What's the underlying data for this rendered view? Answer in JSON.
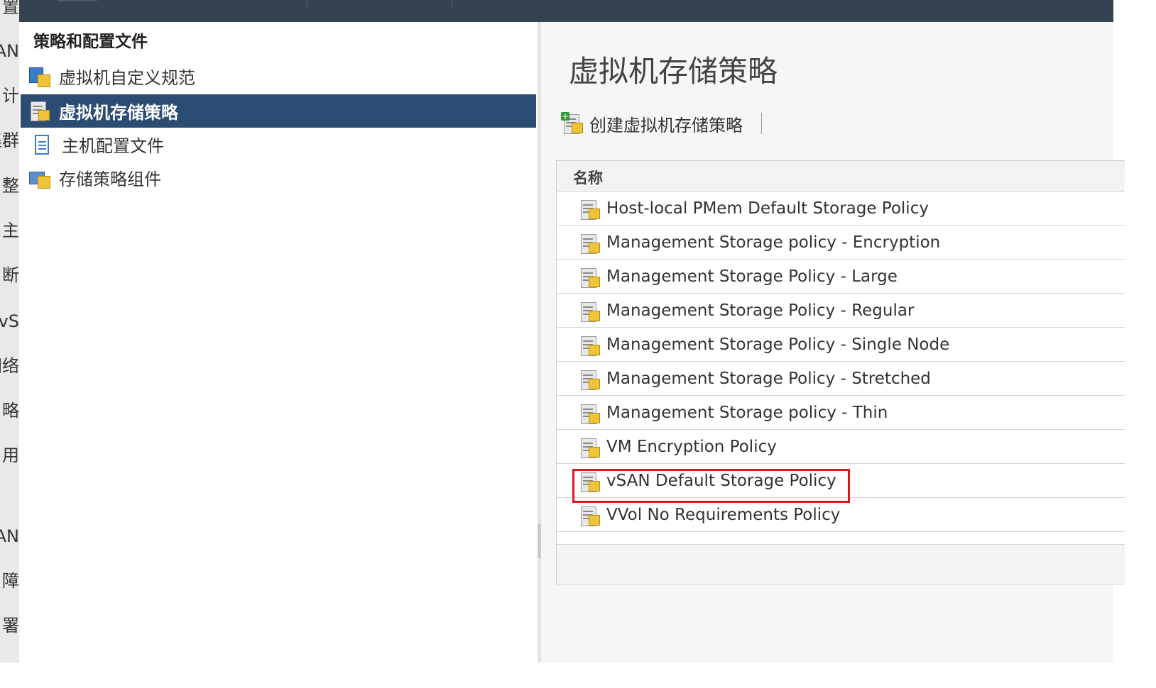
{
  "left_strip": [
    "置",
    "AN",
    "计",
    "集群",
    "整",
    "主",
    "断",
    "vS",
    "网络",
    "略",
    "用",
    "AN",
    "障",
    "署"
  ],
  "nav": {
    "title": "策略和配置文件",
    "items": [
      {
        "label": "虚拟机自定义规范",
        "icon": "vm-customization-spec-icon",
        "selected": false
      },
      {
        "label": "虚拟机存储策略",
        "icon": "vm-storage-policy-icon",
        "selected": true
      },
      {
        "label": "主机配置文件",
        "icon": "host-profile-icon",
        "selected": false
      },
      {
        "label": "存储策略组件",
        "icon": "storage-policy-component-icon",
        "selected": false
      }
    ]
  },
  "content": {
    "title": "虚拟机存储策略",
    "toolbar": {
      "create_label": "创建虚拟机存储策略"
    },
    "table": {
      "column_name": "名称",
      "rows": [
        "Host-local PMem Default Storage Policy",
        "Management Storage policy - Encryption",
        "Management Storage Policy - Large",
        "Management Storage Policy - Regular",
        "Management Storage Policy - Single Node",
        "Management Storage Policy - Stretched",
        "Management Storage policy - Thin",
        "VM Encryption Policy",
        "vSAN Default Storage Policy",
        "VVol No Requirements Policy"
      ],
      "highlighted_row": "vSAN Default Storage Policy"
    }
  },
  "colors": {
    "topbar": "#34434f",
    "selected_nav": "#2b4c73",
    "highlight_border": "#e0161d"
  }
}
